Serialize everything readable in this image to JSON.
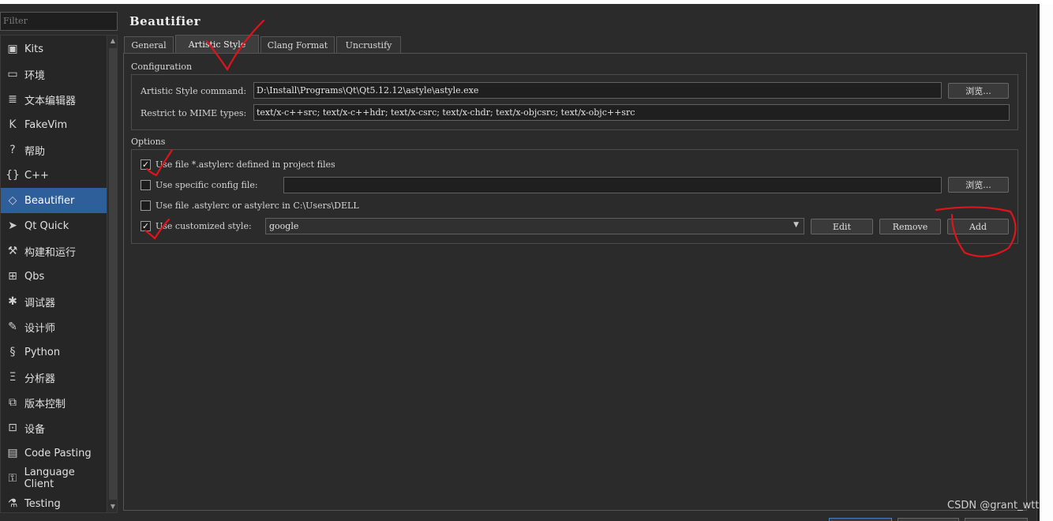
{
  "filter": {
    "placeholder": "Filter"
  },
  "sidebar": {
    "items": [
      {
        "label": "Kits",
        "icon": "kits-icon",
        "glyph": "▣"
      },
      {
        "label": "环境",
        "icon": "monitor-icon",
        "glyph": "▭"
      },
      {
        "label": "文本编辑器",
        "icon": "text-editor-icon",
        "glyph": "≣"
      },
      {
        "label": "FakeVim",
        "icon": "fakevim-icon",
        "glyph": "K"
      },
      {
        "label": "帮助",
        "icon": "help-icon",
        "glyph": "?"
      },
      {
        "label": "C++",
        "icon": "cpp-braces-icon",
        "glyph": "{}"
      },
      {
        "label": "Beautifier",
        "icon": "diamond-icon",
        "glyph": "◇"
      },
      {
        "label": "Qt Quick",
        "icon": "paper-plane-icon",
        "glyph": "➤"
      },
      {
        "label": "构建和运行",
        "icon": "hammer-icon",
        "glyph": "⚒"
      },
      {
        "label": "Qbs",
        "icon": "qbs-grid-icon",
        "glyph": "⊞"
      },
      {
        "label": "调试器",
        "icon": "bug-icon",
        "glyph": "✱"
      },
      {
        "label": "设计师",
        "icon": "pen-icon",
        "glyph": "✎"
      },
      {
        "label": "Python",
        "icon": "python-icon",
        "glyph": "§"
      },
      {
        "label": "分析器",
        "icon": "analyzer-icon",
        "glyph": "Ξ"
      },
      {
        "label": "版本控制",
        "icon": "version-control-icon",
        "glyph": "⧉"
      },
      {
        "label": "设备",
        "icon": "device-icon",
        "glyph": "⊡"
      },
      {
        "label": "Code Pasting",
        "icon": "clipboard-icon",
        "glyph": "▤"
      },
      {
        "label": "Language Client",
        "icon": "language-client-icon",
        "glyph": "⚿"
      },
      {
        "label": "Testing",
        "icon": "flask-icon",
        "glyph": "⚗"
      }
    ],
    "active_index": 6
  },
  "page": {
    "title": "Beautifier"
  },
  "tabs": [
    {
      "label": "General"
    },
    {
      "label": "Artistic Style"
    },
    {
      "label": "Clang Format"
    },
    {
      "label": "Uncrustify"
    }
  ],
  "configuration": {
    "group_title": "Configuration",
    "command_label": "Artistic Style command:",
    "command_value": "D:\\Install\\Programs\\Qt\\Qt5.12.12\\astyle\\astyle.exe",
    "browse_label": "浏览...",
    "mime_label": "Restrict to MIME types:",
    "mime_value": "text/x-c++src; text/x-c++hdr; text/x-csrc; text/x-chdr; text/x-objcsrc; text/x-objc++src"
  },
  "options": {
    "group_title": "Options",
    "use_project_file_label": "Use file *.astylerc defined in project files",
    "use_project_file_checked": true,
    "use_specific_label": "Use specific config file:",
    "use_specific_checked": false,
    "specific_value": "",
    "browse_label": "浏览...",
    "use_home_label": "Use file .astylerc or astylerc in C:\\Users\\DELL",
    "use_home_checked": false,
    "use_custom_label": "Use customized style:",
    "use_custom_checked": true,
    "custom_style_value": "google",
    "edit_label": "Edit",
    "remove_label": "Remove",
    "add_label": "Add"
  },
  "watermark": "CSDN @grant_wtt",
  "colors": {
    "accent": "#2f5f9a",
    "annotation": "#e0141b",
    "background": "#2b2b2b"
  }
}
